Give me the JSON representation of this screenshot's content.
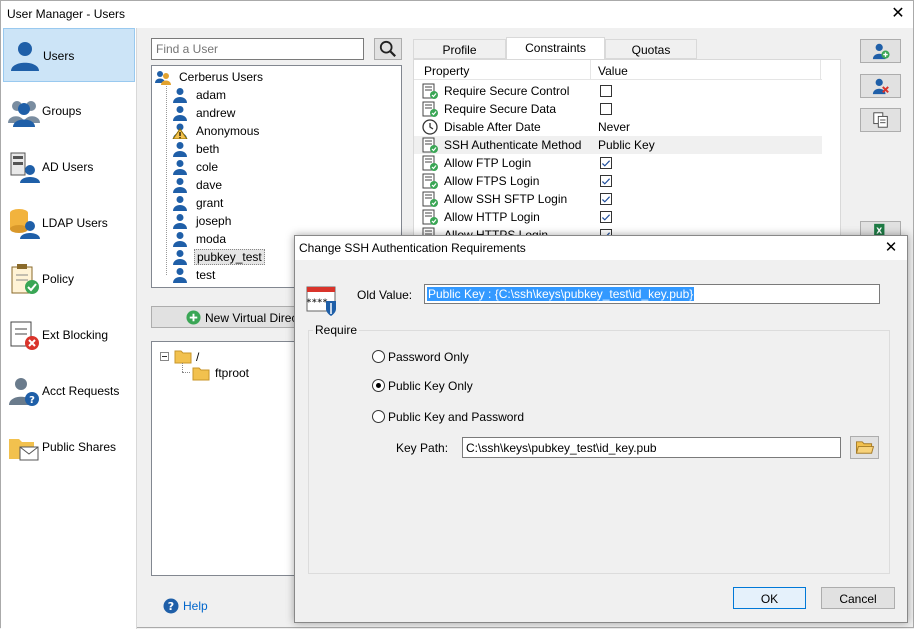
{
  "window": {
    "title": "User Manager - Users",
    "close_glyph": "✕"
  },
  "nav": {
    "items": [
      {
        "label": "Users",
        "icon": "users-icon"
      },
      {
        "label": "Groups",
        "icon": "groups-icon"
      },
      {
        "label": "AD Users",
        "icon": "ad-users-icon"
      },
      {
        "label": "LDAP Users",
        "icon": "ldap-users-icon"
      },
      {
        "label": "Policy",
        "icon": "policy-icon"
      },
      {
        "label": "Ext Blocking",
        "icon": "ext-blocking-icon"
      },
      {
        "label": "Acct Requests",
        "icon": "acct-requests-icon"
      },
      {
        "label": "Public Shares",
        "icon": "public-shares-icon"
      }
    ]
  },
  "search": {
    "placeholder": "Find a User"
  },
  "user_tree": {
    "root": "Cerberus Users",
    "users": [
      "adam",
      "andrew",
      "Anonymous",
      "beth",
      "cole",
      "dave",
      "grant",
      "joseph",
      "moda",
      "pubkey_test",
      "test"
    ],
    "selected": "pubkey_test"
  },
  "vdir": {
    "new_button": "New Virtual Directo",
    "root": "/",
    "child": "ftproot"
  },
  "help": {
    "label": "Help"
  },
  "tabs": [
    {
      "label": "Profile"
    },
    {
      "label": "Constraints"
    },
    {
      "label": "Quotas"
    }
  ],
  "props": {
    "col_property": "Property",
    "col_value": "Value",
    "rows": [
      {
        "name": "Require Secure Control",
        "checked": false
      },
      {
        "name": "Require Secure Data",
        "checked": false
      },
      {
        "name": "Disable After Date",
        "value": "Never"
      },
      {
        "name": "SSH Authenticate Method",
        "value": "Public Key"
      },
      {
        "name": "Allow FTP Login",
        "checked": true
      },
      {
        "name": "Allow FTPS Login",
        "checked": true
      },
      {
        "name": "Allow SSH SFTP Login",
        "checked": true
      },
      {
        "name": "Allow HTTP Login",
        "checked": true
      },
      {
        "name": "Allow HTTPS Login",
        "checked": true
      }
    ]
  },
  "dialog": {
    "title": "Change SSH Authentication Requirements",
    "old_value_label": "Old Value:",
    "old_value": "Public Key : {C:\\ssh\\keys\\pubkey_test\\id_key.pub}",
    "require_label": "Require",
    "options": [
      {
        "label": "Password Only",
        "selected": false
      },
      {
        "label": "Public Key Only",
        "selected": true
      },
      {
        "label": "Public Key and Password",
        "selected": false
      }
    ],
    "key_path_label": "Key Path:",
    "key_path": "C:\\ssh\\keys\\pubkey_test\\id_key.pub",
    "ok": "OK",
    "cancel": "Cancel"
  },
  "colors": {
    "accent": "#0078d7",
    "selection": "#3399ff",
    "nav_active": "#cce4f7",
    "icon_blue": "#1f5fa8"
  }
}
